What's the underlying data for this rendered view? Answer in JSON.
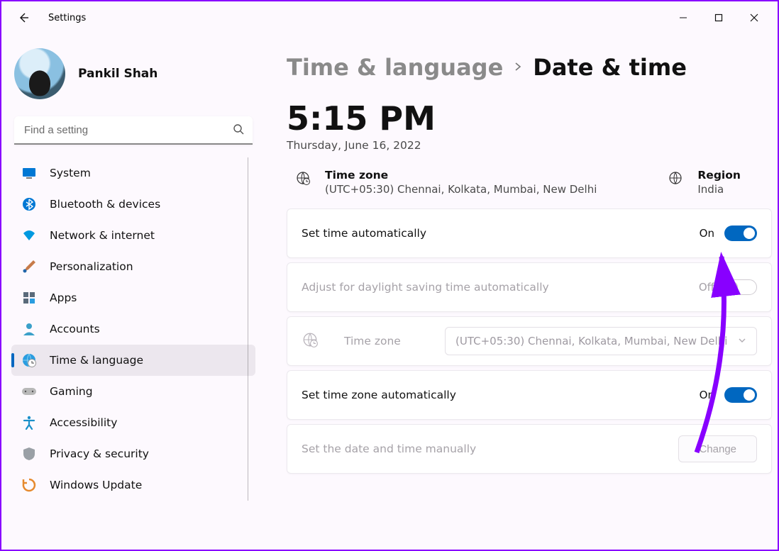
{
  "window": {
    "title": "Settings"
  },
  "profile": {
    "name": "Pankil Shah"
  },
  "search": {
    "placeholder": "Find a setting"
  },
  "nav": {
    "items": [
      {
        "id": "system",
        "label": "System",
        "icon": "monitor"
      },
      {
        "id": "bluetooth",
        "label": "Bluetooth & devices",
        "icon": "bluetooth"
      },
      {
        "id": "network",
        "label": "Network & internet",
        "icon": "wifi"
      },
      {
        "id": "personalization",
        "label": "Personalization",
        "icon": "brush"
      },
      {
        "id": "apps",
        "label": "Apps",
        "icon": "apps"
      },
      {
        "id": "accounts",
        "label": "Accounts",
        "icon": "person"
      },
      {
        "id": "time",
        "label": "Time & language",
        "icon": "globe-clock",
        "selected": true
      },
      {
        "id": "gaming",
        "label": "Gaming",
        "icon": "gamepad"
      },
      {
        "id": "accessibility",
        "label": "Accessibility",
        "icon": "accessibility"
      },
      {
        "id": "privacy",
        "label": "Privacy & security",
        "icon": "shield"
      },
      {
        "id": "update",
        "label": "Windows Update",
        "icon": "update"
      }
    ]
  },
  "breadcrumb": {
    "parent": "Time & language",
    "current": "Date & time"
  },
  "clock": {
    "time": "5:15 PM",
    "date": "Thursday, June 16, 2022"
  },
  "info": {
    "timezone_label": "Time zone",
    "timezone_value": "(UTC+05:30) Chennai, Kolkata, Mumbai, New Delhi",
    "region_label": "Region",
    "region_value": "India"
  },
  "settings": {
    "set_time_auto": {
      "label": "Set time automatically",
      "state": "On",
      "on": true
    },
    "dst_auto": {
      "label": "Adjust for daylight saving time automatically",
      "state": "Off",
      "on": false,
      "disabled": true
    },
    "timezone_select": {
      "label": "Time zone",
      "selected": "(UTC+05:30) Chennai, Kolkata, Mumbai, New Delhi",
      "disabled": true
    },
    "set_tz_auto": {
      "label": "Set time zone automatically",
      "state": "On",
      "on": true
    },
    "set_manual": {
      "label": "Set the date and time manually",
      "button": "Change",
      "disabled": true
    }
  }
}
